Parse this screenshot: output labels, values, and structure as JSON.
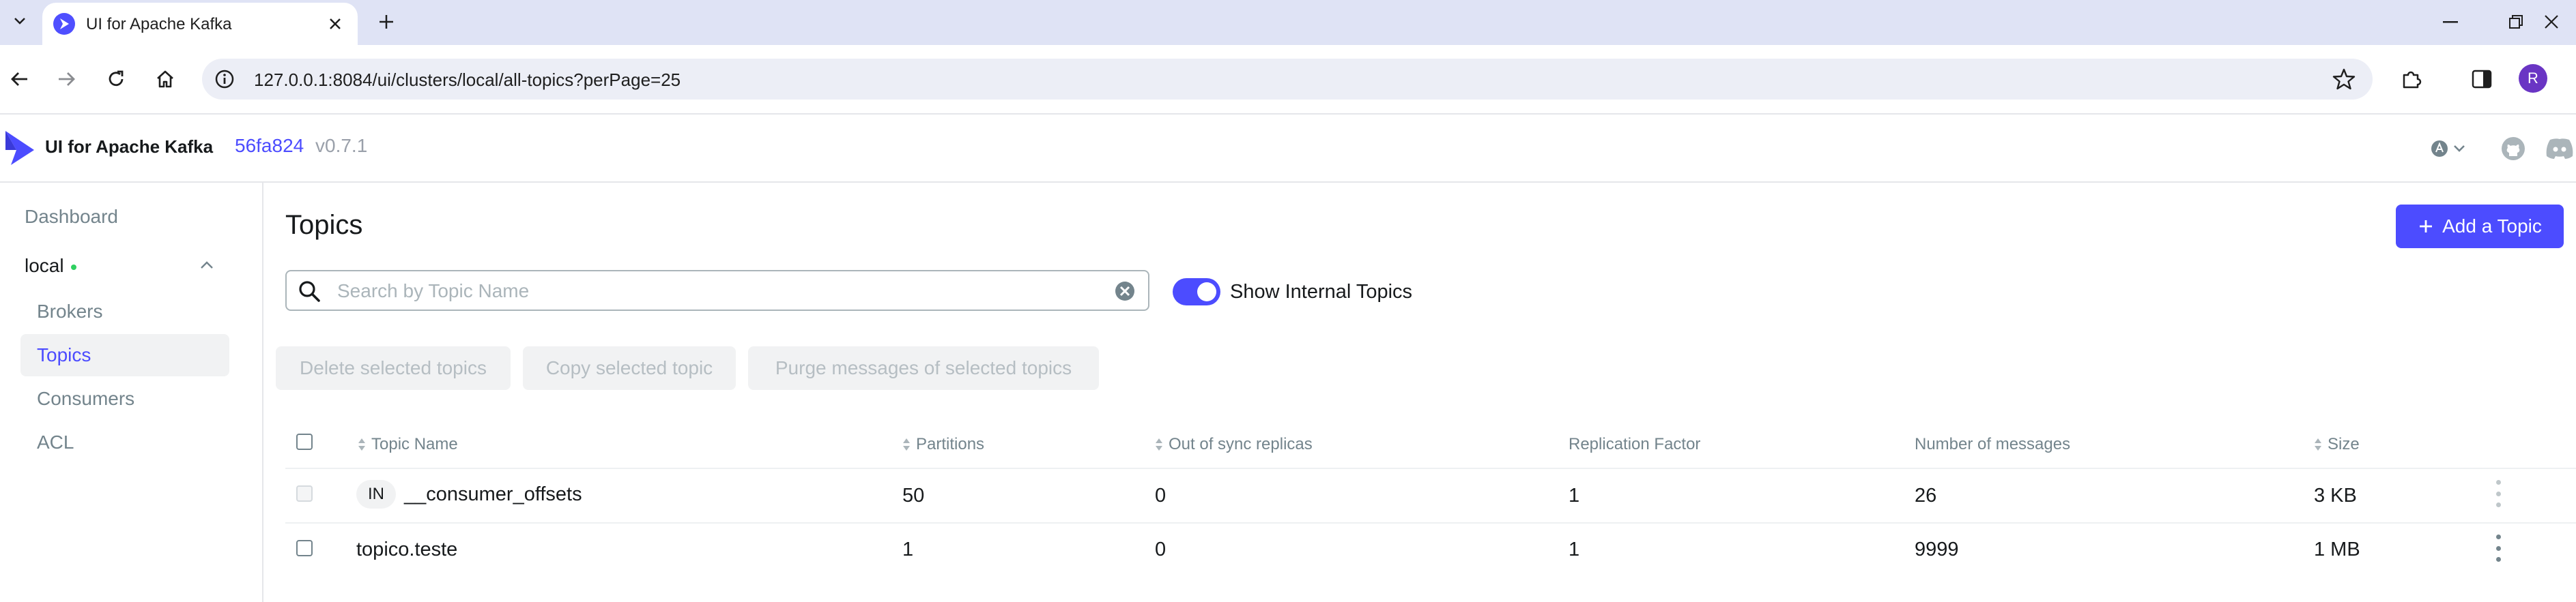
{
  "browser": {
    "tab_title": "UI for Apache Kafka",
    "url": "127.0.0.1:8084/ui/clusters/local/all-topics?perPage=25",
    "profile_initial": "R"
  },
  "header": {
    "app_title": "UI for Apache Kafka",
    "version_hash": "56fa824",
    "version": "v0.7.1"
  },
  "sidebar": {
    "dashboard": "Dashboard",
    "cluster": "local",
    "items": [
      {
        "label": "Brokers"
      },
      {
        "label": "Topics"
      },
      {
        "label": "Consumers"
      },
      {
        "label": "ACL"
      }
    ]
  },
  "main": {
    "title": "Topics",
    "add_button": "Add a Topic",
    "search_placeholder": "Search by Topic Name",
    "toggle_label": "Show Internal Topics",
    "actions": {
      "delete": "Delete selected topics",
      "copy": "Copy selected topic",
      "purge": "Purge messages of selected topics"
    },
    "columns": {
      "name": "Topic Name",
      "partitions": "Partitions",
      "out_of_sync": "Out of sync replicas",
      "replication": "Replication Factor",
      "messages": "Number of messages",
      "size": "Size"
    },
    "rows": [
      {
        "badge": "IN",
        "name": "__consumer_offsets",
        "partitions": "50",
        "out_of_sync": "0",
        "replication": "1",
        "messages": "26",
        "size": "3 KB"
      },
      {
        "badge": "",
        "name": "topico.teste",
        "partitions": "1",
        "out_of_sync": "0",
        "replication": "1",
        "messages": "9999",
        "size": "1 MB"
      }
    ]
  },
  "colors": {
    "accent": "#4c4cff",
    "status_online": "#2fd060",
    "muted_text": "#73848c"
  }
}
